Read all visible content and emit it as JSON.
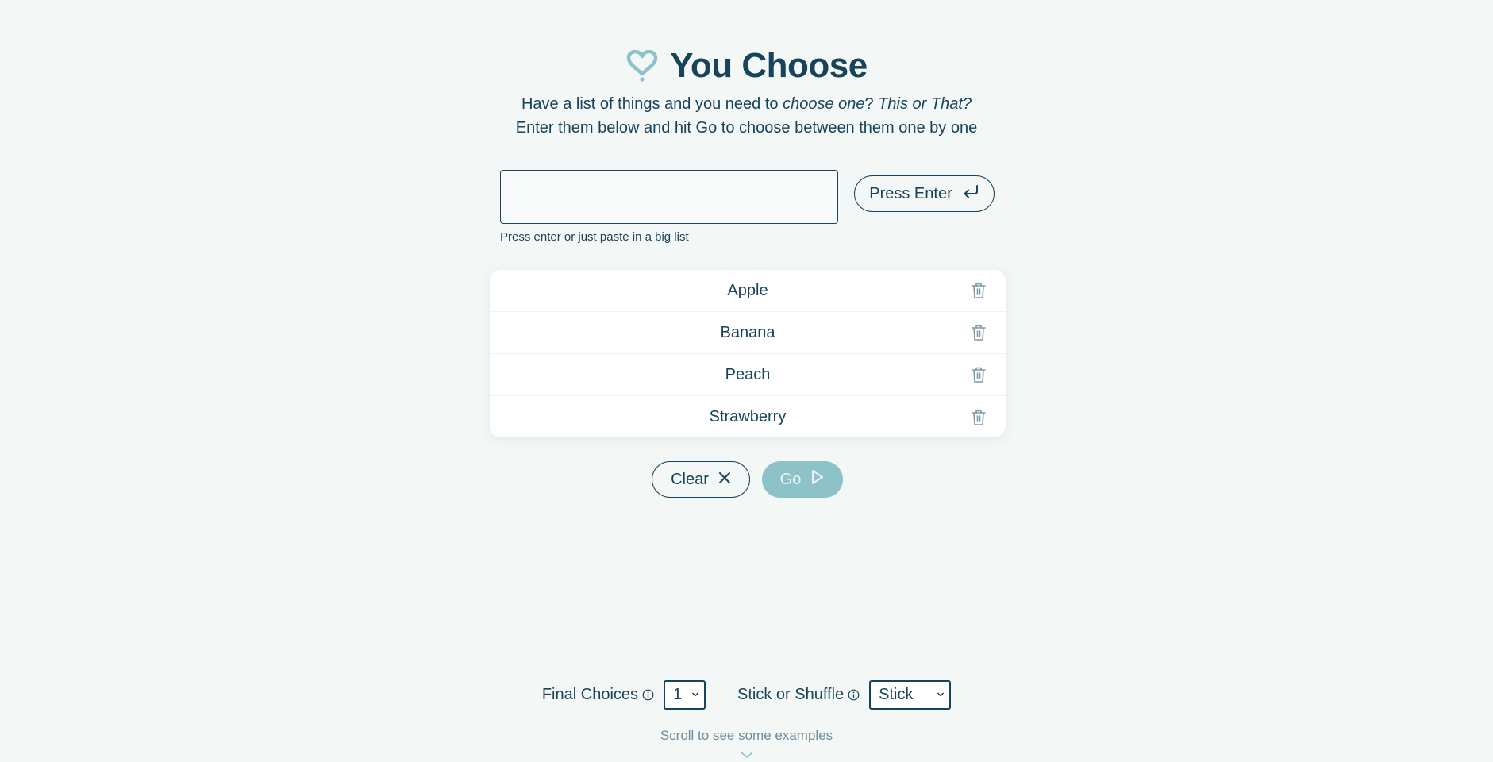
{
  "app": {
    "title": "You Choose",
    "subtitle_line1_prefix": "Have a list of things and you need to ",
    "subtitle_line1_em1": "choose one",
    "subtitle_line1_q": "? ",
    "subtitle_line1_em2": "This or That?",
    "subtitle_line2": "Enter them below and hit Go to choose between them one by one"
  },
  "entry": {
    "value": "",
    "placeholder": "",
    "hint": "Press enter or just paste in a big list",
    "enter_label": "Press Enter"
  },
  "items": [
    {
      "label": "Apple"
    },
    {
      "label": "Banana"
    },
    {
      "label": "Peach"
    },
    {
      "label": "Strawberry"
    }
  ],
  "actions": {
    "clear_label": "Clear",
    "go_label": "Go"
  },
  "settings": {
    "final_choices_label": "Final Choices",
    "final_choices_value": "1",
    "stick_label": "Stick or Shuffle",
    "stick_value": "Stick"
  },
  "scroll_hint": "Scroll to see some examples",
  "colors": {
    "primary": "#17435b",
    "accent": "#8cc2c8",
    "background": "#f3f7f6"
  },
  "icons": [
    "heart-logo-icon",
    "enter-icon",
    "trash-icon",
    "close-icon",
    "play-icon",
    "info-icon",
    "chevron-down-icon"
  ]
}
